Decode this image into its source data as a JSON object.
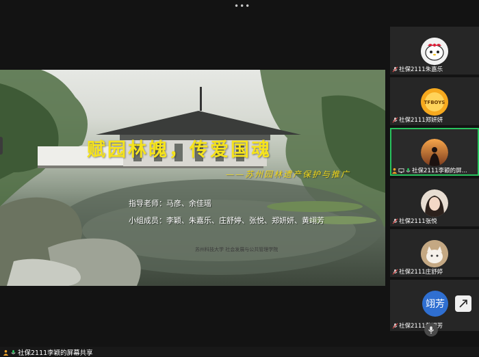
{
  "top_menu": "•••",
  "slide": {
    "title": "赋园林魄，传爱国魂",
    "subtitle": "——苏州园林遗产保护与推广",
    "advisor": "指导老师：马彦、余佳瑶",
    "members": "小组成员：李颖、朱嘉乐、庄舒婷、张悦、郑妍妍、黄翊芳",
    "school": "苏州科技大学  社会发展与公共管理学院"
  },
  "participants": [
    {
      "name": "社保2111朱嘉乐",
      "avatar": "cartoon-avatar"
    },
    {
      "name": "社保2111郑妍妍",
      "avatar": "orange-badge-avatar",
      "badge_text": "TFBOYS"
    },
    {
      "name": "社保2111李颖的屏...",
      "avatar": "sunset-silhouette-avatar",
      "active": true
    },
    {
      "name": "社保2111张悦",
      "avatar": "girl-photo-avatar"
    },
    {
      "name": "社保2111庄舒婷",
      "avatar": "cat-photo-avatar"
    },
    {
      "name": "社保2111黄翊芳",
      "avatar_letter": "翊芳"
    }
  ],
  "bottom_bar": {
    "share_label": "社保2111李颖的屏幕共享"
  },
  "colors": {
    "active_border": "#29c45e",
    "title_yellow": "#f5e31d",
    "letter_avatar": "#2f6fd1"
  }
}
